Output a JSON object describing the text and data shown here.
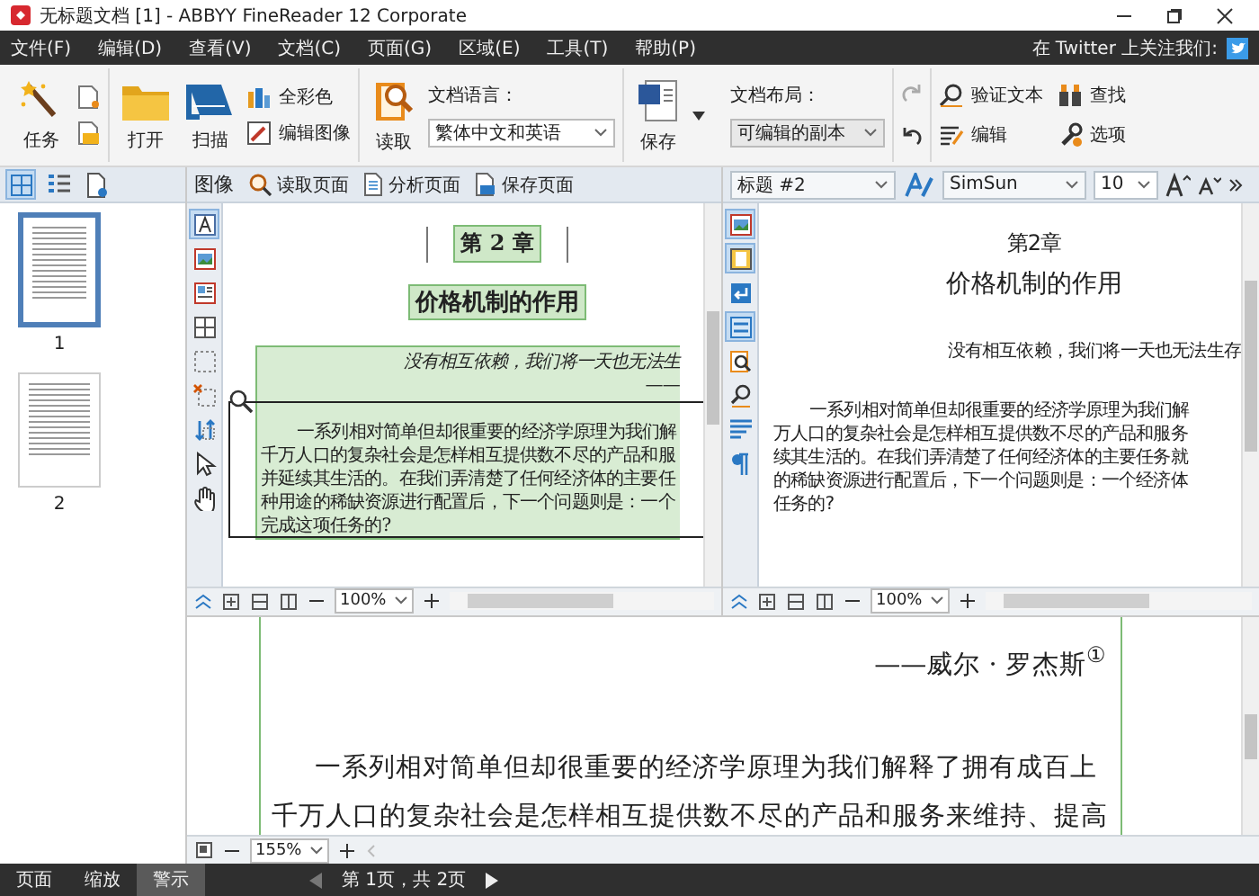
{
  "window": {
    "title": "无标题文档 [1] - ABBYY FineReader 12 Corporate"
  },
  "menu": [
    "文件(F)",
    "编辑(D)",
    "查看(V)",
    "文档(C)",
    "页面(G)",
    "区域(E)",
    "工具(T)",
    "帮助(P)"
  ],
  "social": {
    "label": "在 Twitter 上关注我们:"
  },
  "ribbon": {
    "task": "任务",
    "open": "打开",
    "scan": "扫描",
    "full_color": "全彩色",
    "edit_image": "编辑图像",
    "read": "读取",
    "language_label": "文档语言：",
    "language": "繁体中文和英语",
    "save": "保存",
    "layout_label": "文档布局：",
    "layout": "可编辑的副本",
    "verify": "验证文本",
    "find": "查找",
    "edit": "编辑",
    "options": "选项"
  },
  "pages_panel": {
    "views": [
      {
        "kind": "thumbnails",
        "selected": true
      },
      {
        "kind": "details",
        "selected": false
      },
      {
        "kind": "properties",
        "selected": false
      }
    ],
    "pages": [
      {
        "number": "1",
        "selected": true
      },
      {
        "number": "2",
        "selected": false
      }
    ]
  },
  "image_pane": {
    "label": "图像",
    "buttons": [
      "读取页面",
      "分析页面",
      "保存页面"
    ],
    "tools": [
      {
        "kind": "text",
        "selected": true
      },
      {
        "kind": "picture",
        "selected": false
      },
      {
        "kind": "table",
        "selected": false
      },
      {
        "kind": "grid",
        "selected": false
      },
      {
        "kind": "background",
        "selected": false
      },
      {
        "kind": "delete",
        "selected": false
      },
      {
        "kind": "order",
        "selected": false
      },
      {
        "kind": "pointer",
        "selected": false
      },
      {
        "kind": "hand",
        "selected": false
      }
    ],
    "chapter": "第 2 章",
    "title": "价格机制的作用",
    "epigraph": "没有相互依赖，我们将一天也无法生",
    "attribution": "——",
    "lines": [
      "一系列相对简单但却很重要的经济学原理为我们解",
      "千万人口的复杂社会是怎样相互提供数不尽的产品和服",
      "并延续其生活的。在我们弄清楚了任何经济体的主要任",
      "种用途的稀缺资源进行配置后，下一个问题则是：一个",
      "完成这项任务的?"
    ],
    "zoom": "100%"
  },
  "text_pane": {
    "style": "标题 #2",
    "font": "SimSun",
    "size": "10",
    "tools": [
      {
        "kind": "picture",
        "selected": true
      },
      {
        "kind": "frame",
        "selected": true
      },
      {
        "kind": "return",
        "selected": false
      },
      {
        "kind": "compare",
        "selected": true
      },
      {
        "kind": "zoom",
        "selected": false
      },
      {
        "kind": "verify",
        "selected": false
      },
      {
        "kind": "checklist",
        "selected": false
      },
      {
        "kind": "pilcrow",
        "selected": false
      }
    ],
    "chapter": "第2章",
    "title": "价格机制的作用",
    "epigraph": "没有相互依赖，我们将一天也无法生存",
    "lines": [
      "一系列相对简单但却很重要的经济学原理为我们解",
      "万人口的复杂社会是怎样相互提供数不尽的产品和服务",
      "续其生活的。在我们弄清楚了任何经济体的主要任务就",
      "的稀缺资源进行配置后，下一个问题则是：一个经济体",
      "任务的?"
    ],
    "zoom": "100%"
  },
  "zoom_pane": {
    "attribution": "——威尔 · 罗杰斯$^{①}$",
    "lines": [
      "一系列相对简单但却很重要的经济学原理为我们解释了拥有成百上",
      "千万人口的复杂社会是怎样相互提供数不尽的产品和服务来维持、提高"
    ],
    "zoom": "155%"
  },
  "status_bar": {
    "tabs": [
      {
        "label": "页面",
        "selected": false
      },
      {
        "label": "缩放",
        "selected": false
      },
      {
        "label": "警示",
        "selected": true
      }
    ],
    "page_info": "第 1页，共 2页"
  }
}
